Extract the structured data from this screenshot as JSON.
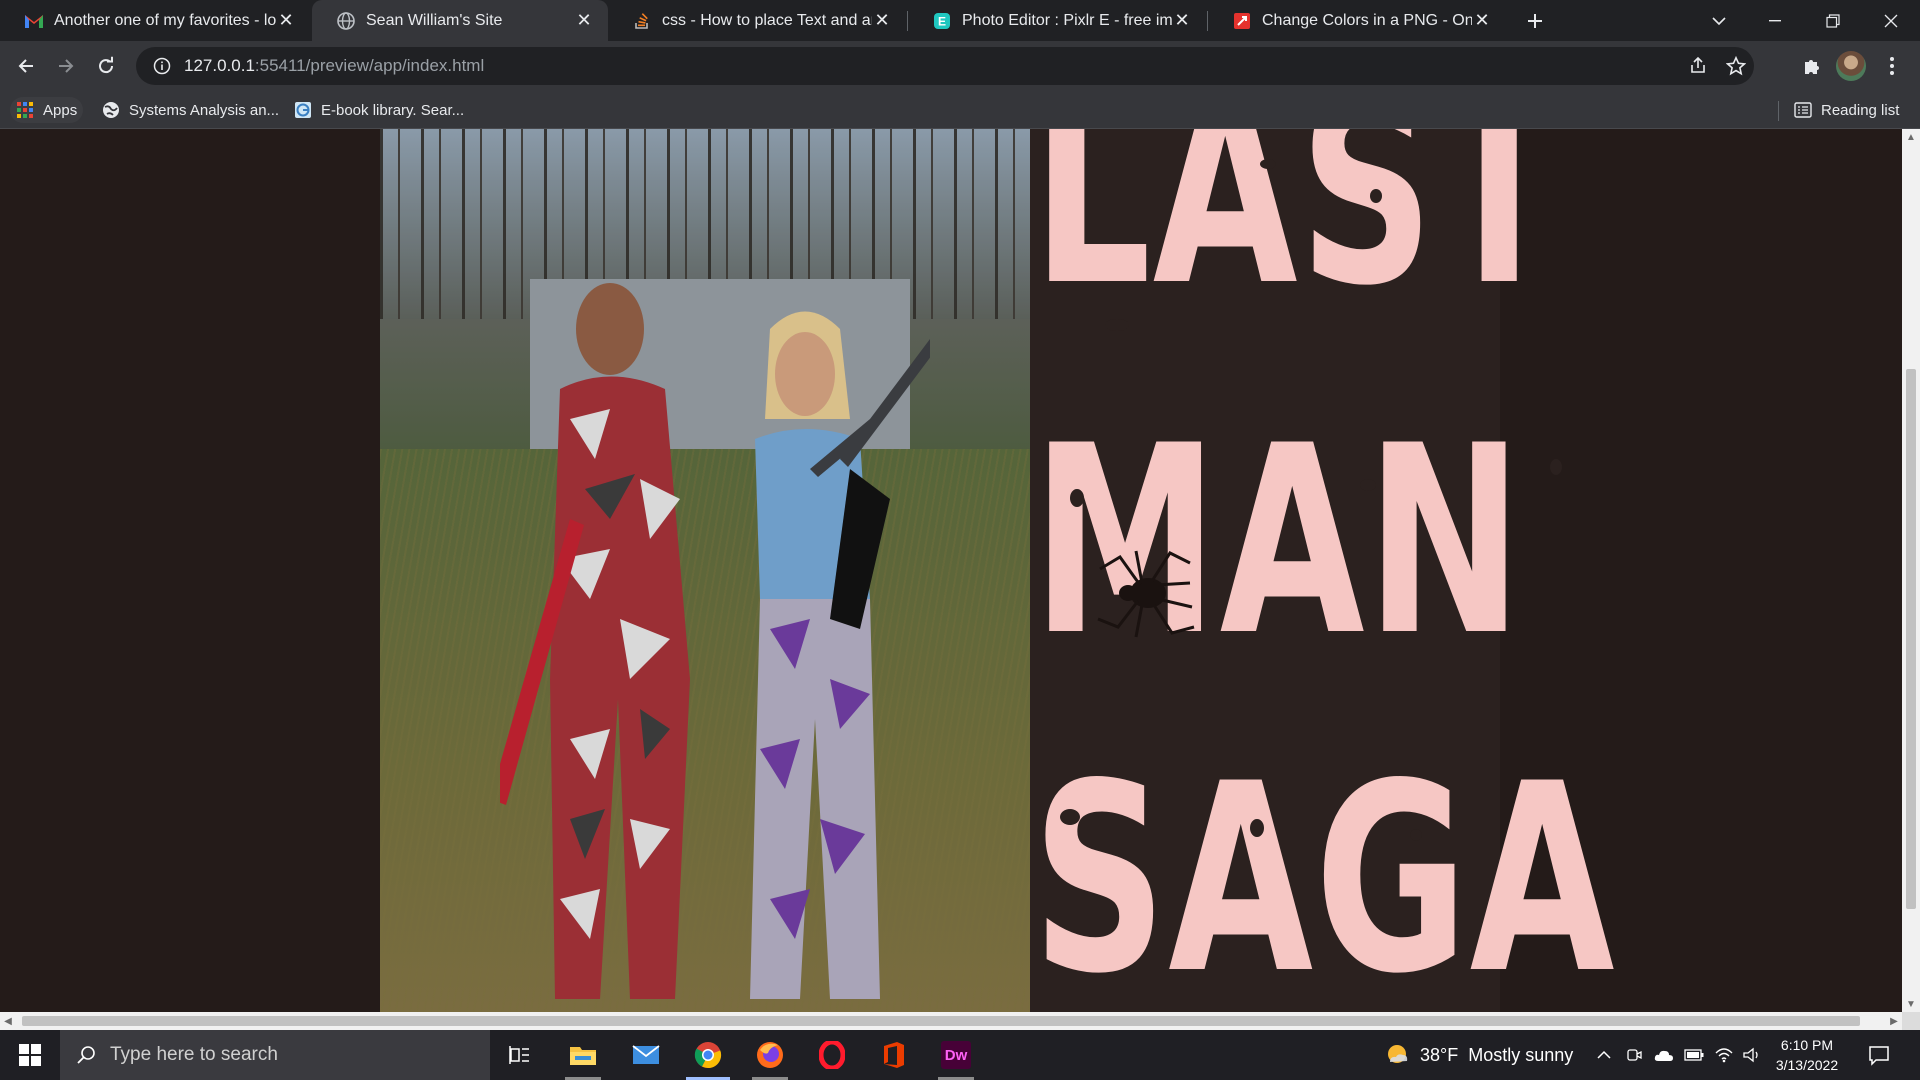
{
  "browser": {
    "tabs": [
      {
        "title": "Another one of my favorites - log",
        "icon": "gmail-icon",
        "active": false
      },
      {
        "title": "Sean William's Site",
        "icon": "globe-icon",
        "active": true
      },
      {
        "title": "css - How to place Text and an Im",
        "icon": "stackoverflow-icon",
        "active": false
      },
      {
        "title": "Photo Editor : Pixlr E - free image",
        "icon": "pixlr-icon",
        "active": false
      },
      {
        "title": "Change Colors in a PNG - Online",
        "icon": "pdf-tool-icon",
        "active": false
      }
    ],
    "url_host": "127.0.0.1",
    "url_path": ":55411/preview/app/index.html",
    "bookmarks": [
      {
        "label": "Apps",
        "icon": "apps-grid-icon"
      },
      {
        "label": "Systems Analysis an...",
        "icon": "globe-icon"
      },
      {
        "label": "E-book library. Sear...",
        "icon": "ebook-icon"
      }
    ],
    "reading_list": "Reading list"
  },
  "page": {
    "title_words": [
      "LAST",
      "MAN",
      "SAGA"
    ],
    "title_color": "#f6c7c4",
    "background": "#2b211f"
  },
  "taskbar": {
    "search_placeholder": "Type here to search",
    "weather_temp": "38°F",
    "weather_desc": "Mostly sunny",
    "time": "6:10 PM",
    "date": "3/13/2022",
    "apps": [
      "task-view",
      "file-explorer",
      "mail",
      "chrome",
      "firefox",
      "opera",
      "office",
      "dreamweaver"
    ],
    "dreamweaver_label": "Dw"
  }
}
